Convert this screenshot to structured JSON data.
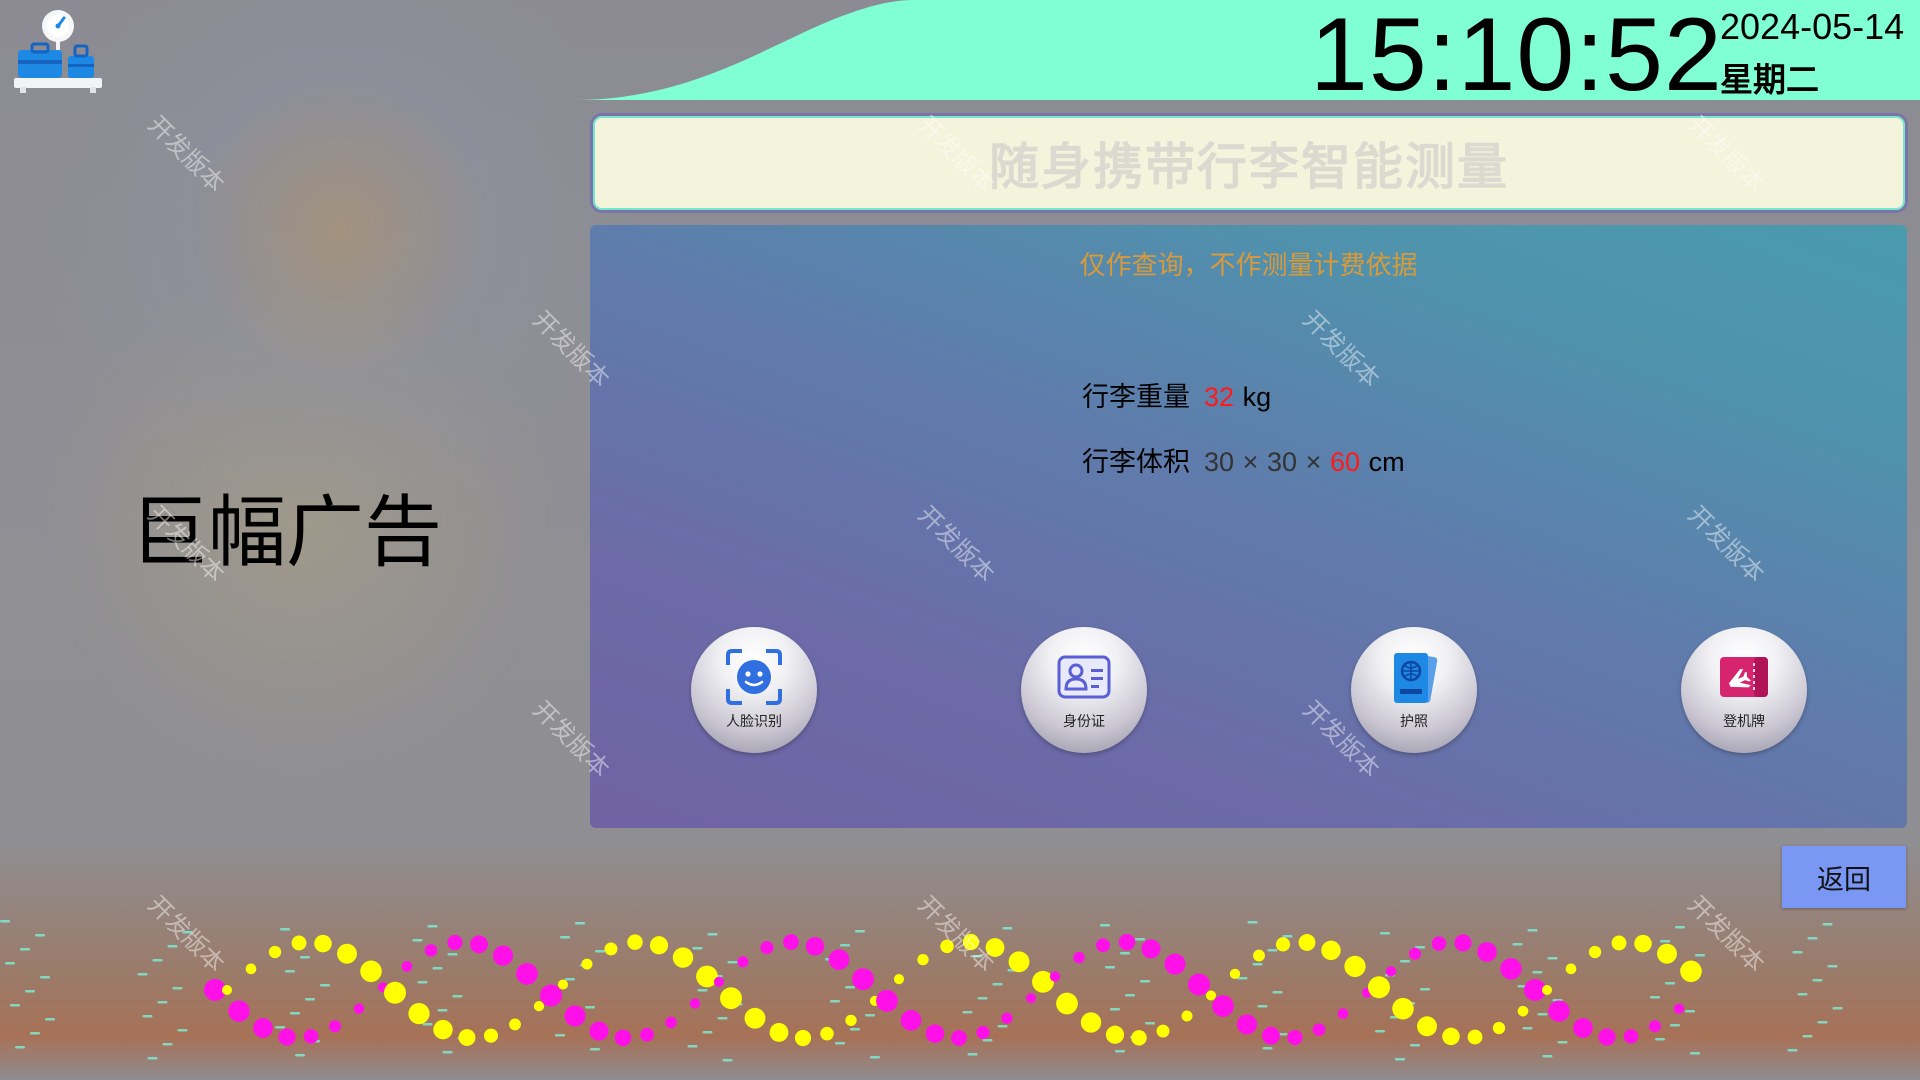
{
  "header": {
    "time": "15:10:52",
    "date": "2024-05-14",
    "weekday": "星期二",
    "title": "随身携带行李智能测量",
    "logo_icon": "luggage-scale-icon"
  },
  "panel": {
    "disclaimer": "仅作查询，不作测量计费依据",
    "weight": {
      "label": "行李重量",
      "value": "32",
      "unit": "kg"
    },
    "volume": {
      "label": "行李体积",
      "length": "30",
      "width": "30",
      "height": "60",
      "times": "×",
      "unit": "cm"
    },
    "buttons": [
      {
        "label": "人脸识别",
        "icon": "face-recognition-icon"
      },
      {
        "label": "身份证",
        "icon": "id-card-icon"
      },
      {
        "label": "护照",
        "icon": "passport-icon"
      },
      {
        "label": "登机牌",
        "icon": "boarding-pass-icon"
      }
    ]
  },
  "ad": {
    "text": "巨幅广告"
  },
  "actions": {
    "back_label": "返回"
  },
  "watermark": "开发版本",
  "colors": {
    "wave": "#80ffd4",
    "highlight_value": "#ff1a1a",
    "disclaimer": "#d89a3a",
    "back_button": "#7a97f3"
  }
}
